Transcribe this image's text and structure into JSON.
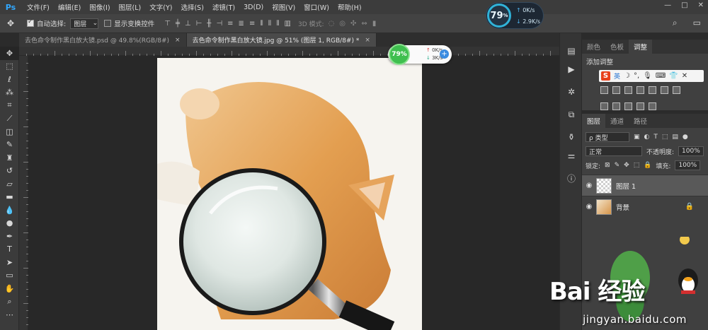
{
  "app": {
    "logo": "Ps"
  },
  "menu": [
    "文件(F)",
    "编辑(E)",
    "图像(I)",
    "图层(L)",
    "文字(Y)",
    "选择(S)",
    "滤镜(T)",
    "3D(D)",
    "视图(V)",
    "窗口(W)",
    "帮助(H)"
  ],
  "window_controls": {
    "minimize": "—",
    "maximize": "□",
    "close": "✕"
  },
  "options": {
    "auto_select_label": "自动选择:",
    "auto_select_value": "图层",
    "show_transform_label": "显示变换控件",
    "mode3d_label": "3D 模式:"
  },
  "speed_widget": {
    "percent": "79",
    "percent_unit": "%",
    "up": "0K/s",
    "down": "2.9K/s"
  },
  "net_widget": {
    "percent": "79%",
    "up": "0K/s",
    "down": "3K/s",
    "plus": "+"
  },
  "tabs": [
    {
      "label": "去色命令制作黑白放大镜.psd @ 49.8%(RGB/8#)",
      "close": "×"
    },
    {
      "label": "去色命令制作黑白放大镜.jpg @ 51% (图层 1, RGB/8#) *",
      "close": "×"
    }
  ],
  "adjust_panel": {
    "tabs": [
      "颜色",
      "色板",
      "调整"
    ],
    "title": "添加调整",
    "ime_label": "英"
  },
  "layers_panel": {
    "tabs": [
      "图层",
      "通道",
      "路径"
    ],
    "filter_kind": "ρ 类型",
    "blend_mode": "正常",
    "opacity_label": "不透明度:",
    "opacity_value": "100%",
    "lock_label": "锁定:",
    "fill_label": "填充:",
    "fill_value": "100%",
    "layers": [
      {
        "name": "图层 1",
        "selected": true
      },
      {
        "name": "背景",
        "selected": false
      }
    ]
  },
  "watermark": {
    "logo": "Bai 经验",
    "url": "jingyan.baidu.com"
  },
  "colors": {
    "menubar": "#3c3c3c",
    "panel": "#404040",
    "canvas": "#282828",
    "accent": "#31a8ff"
  }
}
